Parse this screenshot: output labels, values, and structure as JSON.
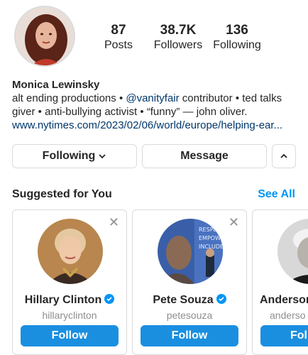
{
  "profile": {
    "stats": [
      {
        "value": "87",
        "label": "Posts"
      },
      {
        "value": "38.7K",
        "label": "Followers"
      },
      {
        "value": "136",
        "label": "Following"
      }
    ],
    "name": "Monica Lewinsky",
    "bio_line1_pre": "alt ending productions • ",
    "bio_mention": "@vanityfair",
    "bio_line1_post": " contributor • ted talks",
    "bio_line2": "giver • anti-bullying activist • “funny” — john oliver.",
    "link": "www.nytimes.com/2023/02/06/world/europe/helping-ear..."
  },
  "actions": {
    "following_label": "Following",
    "message_label": "Message"
  },
  "suggested": {
    "title": "Suggested for You",
    "see_all": "See All",
    "cards": [
      {
        "name": "Hillary Clinton",
        "username": "hillaryclinton",
        "follow_label": "Follow",
        "verified": true
      },
      {
        "name": "Pete Souza",
        "username": "petesouza",
        "follow_label": "Follow",
        "verified": true,
        "mural_text": [
          "RESPECT",
          "EMPOWER",
          "INCLUDE"
        ]
      },
      {
        "name": "Anderson",
        "username": "anderso",
        "follow_label": "Fol"
      }
    ]
  },
  "colors": {
    "accent": "#0095f6",
    "follow_button": "#1a8fe0",
    "border": "#dbdbdb",
    "muted": "#8e8e8e"
  }
}
